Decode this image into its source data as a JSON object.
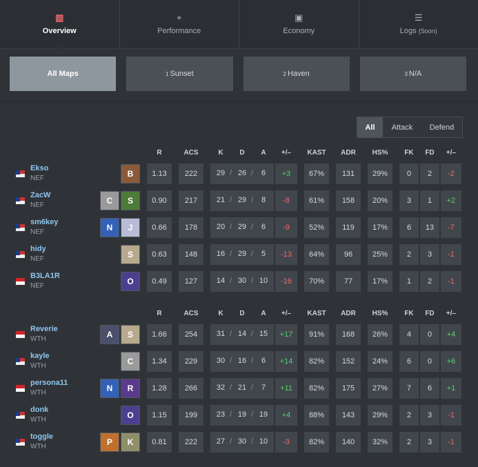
{
  "tabs": [
    {
      "label": "Overview",
      "icon": "bar-chart-icon",
      "glyph": "▥",
      "active": true
    },
    {
      "label": "Performance",
      "icon": "crosshair-icon",
      "glyph": "⌖",
      "active": false
    },
    {
      "label": "Economy",
      "icon": "money-icon",
      "glyph": "▣",
      "active": false
    },
    {
      "label": "Logs",
      "soon": "(Soon)",
      "icon": "list-icon",
      "glyph": "☰",
      "active": false
    }
  ],
  "maps": [
    {
      "num": "",
      "label": "All Maps",
      "active": true
    },
    {
      "num": "1",
      "label": "Sunset",
      "active": false
    },
    {
      "num": "2",
      "label": "Haven",
      "active": false
    },
    {
      "num": "3",
      "label": "N/A",
      "active": false
    }
  ],
  "side_filter": {
    "all": "All",
    "attack": "Attack",
    "defend": "Defend",
    "selected": "All"
  },
  "columns": [
    "R",
    "ACS",
    "K",
    "D",
    "A",
    "+/–",
    "KAST",
    "ADR",
    "HS%",
    "FK",
    "FD",
    "+/–"
  ],
  "teams": [
    {
      "players": [
        {
          "name": "Ekso",
          "team": "NEF",
          "flag": "my",
          "agents": [
            {
              "name": "Brimstone",
              "color": "#8a5a3a"
            }
          ],
          "r": "1.13",
          "acs": "222",
          "k": "29",
          "d": "26",
          "a": "6",
          "pm": "+3",
          "kast": "67%",
          "adr": "131",
          "hs": "29%",
          "fk": "0",
          "fd": "2",
          "fkpm": "-2"
        },
        {
          "name": "ZacW",
          "team": "NEF",
          "flag": "my",
          "agents": [
            {
              "name": "Cypher",
              "color": "#9a9a9a"
            },
            {
              "name": "Skye",
              "color": "#4f7a3a"
            }
          ],
          "r": "0.90",
          "acs": "217",
          "k": "21",
          "d": "29",
          "a": "8",
          "pm": "-8",
          "kast": "61%",
          "adr": "158",
          "hs": "20%",
          "fk": "3",
          "fd": "1",
          "fkpm": "+2"
        },
        {
          "name": "sm6key",
          "team": "NEF",
          "flag": "my",
          "agents": [
            {
              "name": "Neon",
              "color": "#3461b8"
            },
            {
              "name": "Jett",
              "color": "#b8bcd6"
            }
          ],
          "r": "0.66",
          "acs": "178",
          "k": "20",
          "d": "29",
          "a": "6",
          "pm": "-9",
          "kast": "52%",
          "adr": "119",
          "hs": "17%",
          "fk": "6",
          "fd": "13",
          "fkpm": "-7"
        },
        {
          "name": "hidy",
          "team": "NEF",
          "flag": "my",
          "agents": [
            {
              "name": "Sage",
              "color": "#b8a98e"
            }
          ],
          "r": "0.63",
          "acs": "148",
          "k": "16",
          "d": "29",
          "a": "5",
          "pm": "-13",
          "kast": "64%",
          "adr": "96",
          "hs": "25%",
          "fk": "2",
          "fd": "3",
          "fkpm": "-1"
        },
        {
          "name": "B3LA1R",
          "team": "NEF",
          "flag": "sg",
          "agents": [
            {
              "name": "Omen",
              "color": "#4c3f8f"
            }
          ],
          "r": "0.49",
          "acs": "127",
          "k": "14",
          "d": "30",
          "a": "10",
          "pm": "-16",
          "kast": "70%",
          "adr": "77",
          "hs": "17%",
          "fk": "1",
          "fd": "2",
          "fkpm": "-1"
        }
      ]
    },
    {
      "players": [
        {
          "name": "Reverie",
          "team": "WTH",
          "flag": "sg",
          "agents": [
            {
              "name": "Astra",
              "color": "#4a4f6a"
            },
            {
              "name": "Sage",
              "color": "#b8a98e"
            }
          ],
          "r": "1.66",
          "acs": "254",
          "k": "31",
          "d": "14",
          "a": "15",
          "pm": "+17",
          "kast": "91%",
          "adr": "168",
          "hs": "26%",
          "fk": "4",
          "fd": "0",
          "fkpm": "+4"
        },
        {
          "name": "kayle",
          "team": "WTH",
          "flag": "my",
          "agents": [
            {
              "name": "Cypher",
              "color": "#9a9a9a"
            }
          ],
          "r": "1.34",
          "acs": "229",
          "k": "30",
          "d": "16",
          "a": "6",
          "pm": "+14",
          "kast": "82%",
          "adr": "152",
          "hs": "24%",
          "fk": "6",
          "fd": "0",
          "fkpm": "+6"
        },
        {
          "name": "persona11",
          "team": "WTH",
          "flag": "sg",
          "agents": [
            {
              "name": "Neon",
              "color": "#3461b8"
            },
            {
              "name": "Reyna",
              "color": "#5a3a8a"
            }
          ],
          "r": "1.28",
          "acs": "266",
          "k": "32",
          "d": "21",
          "a": "7",
          "pm": "+11",
          "kast": "82%",
          "adr": "175",
          "hs": "27%",
          "fk": "7",
          "fd": "6",
          "fkpm": "+1"
        },
        {
          "name": "donk",
          "team": "WTH",
          "flag": "my",
          "agents": [
            {
              "name": "Omen",
              "color": "#4c3f8f"
            }
          ],
          "r": "1.15",
          "acs": "199",
          "k": "23",
          "d": "19",
          "a": "19",
          "pm": "+4",
          "kast": "88%",
          "adr": "143",
          "hs": "29%",
          "fk": "2",
          "fd": "3",
          "fkpm": "-1"
        },
        {
          "name": "toggle",
          "team": "WTH",
          "flag": "my",
          "agents": [
            {
              "name": "Phoenix",
              "color": "#c0702e"
            },
            {
              "name": "Killjoy",
              "color": "#8f8f6a"
            }
          ],
          "r": "0.81",
          "acs": "222",
          "k": "27",
          "d": "30",
          "a": "10",
          "pm": "-3",
          "kast": "82%",
          "adr": "140",
          "hs": "32%",
          "fk": "2",
          "fd": "3",
          "fkpm": "-1"
        }
      ]
    }
  ]
}
